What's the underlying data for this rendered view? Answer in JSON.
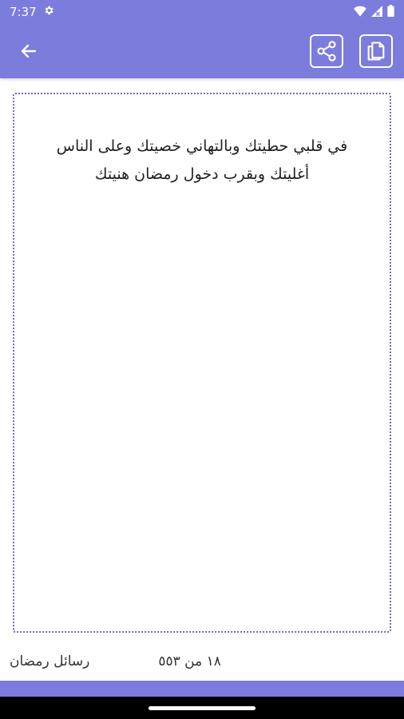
{
  "status_bar": {
    "time": "7:37",
    "icons": [
      "gear-icon",
      "wifi-icon",
      "signal-icon",
      "battery-icon"
    ]
  },
  "app_bar": {
    "back_icon": "arrow-left-icon",
    "share_icon": "share-icon",
    "copy_icon": "copy-icon"
  },
  "message": {
    "text": "في قلبي حطيتك وبالتهاني خصيتك وعلى الناس أغليتك وبقرب دخول رمضان هنيتك"
  },
  "footer": {
    "category": "رسائل رمضان",
    "counter": "١٨ من ٥٥٣"
  },
  "colors": {
    "primary": "#7c7cdc",
    "card_border": "#6b6bc8",
    "text": "#222222"
  }
}
